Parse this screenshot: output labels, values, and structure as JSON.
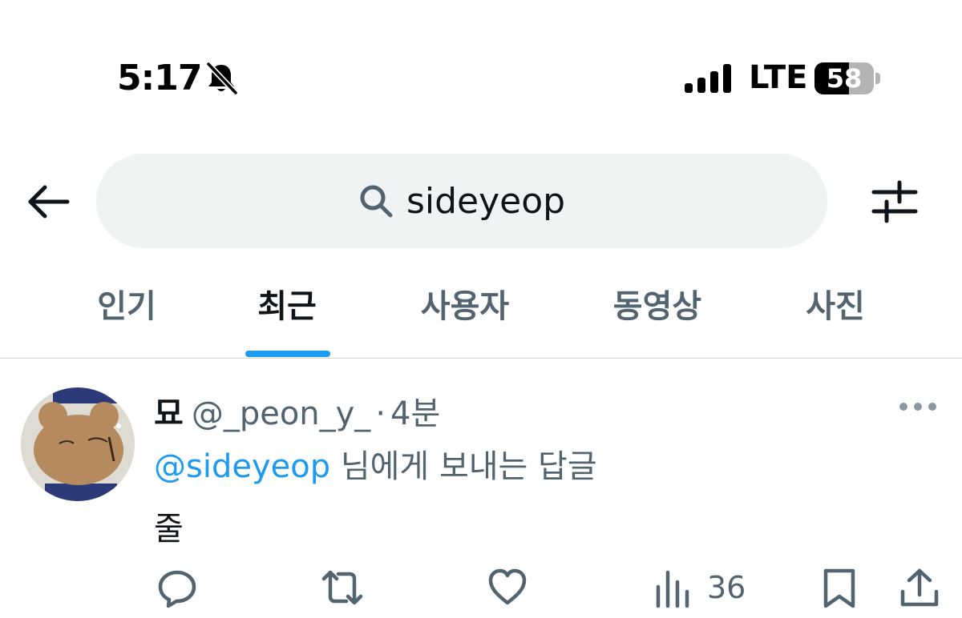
{
  "status_bar": {
    "time": "5:17",
    "mute_icon": "bell-slash-icon",
    "signal_icon": "cellular-signal-icon",
    "network": "LTE",
    "battery_level": "58",
    "battery_fraction": 0.58
  },
  "header": {
    "back_icon": "arrow-left-icon",
    "search": {
      "icon": "search-icon",
      "query": "sideyeop"
    },
    "filter_icon": "sliders-icon"
  },
  "tabs": [
    {
      "label": "인기",
      "active": false
    },
    {
      "label": "최근",
      "active": true
    },
    {
      "label": "사용자",
      "active": false
    },
    {
      "label": "동영상",
      "active": false
    },
    {
      "label": "사진",
      "active": false
    }
  ],
  "post": {
    "author_name": "묘",
    "author_handle": "@_peon_y_",
    "separator": "·",
    "time": "4분",
    "more_icon": "more-horizontal-icon",
    "reply_to_handle": "@sideyeop",
    "reply_to_suffix": " 님에게 보내는 답글",
    "text": "줄",
    "actions": {
      "reply_icon": "reply-icon",
      "retweet_icon": "retweet-icon",
      "like_icon": "heart-icon",
      "views_icon": "views-chart-icon",
      "views_count": "36",
      "bookmark_icon": "bookmark-icon",
      "share_icon": "share-icon"
    }
  },
  "colors": {
    "accent": "#1d9bf0",
    "secondary_text": "#536471",
    "primary_text": "#0f1419",
    "search_bg": "#eff3f4",
    "divider": "#cfd9de"
  }
}
